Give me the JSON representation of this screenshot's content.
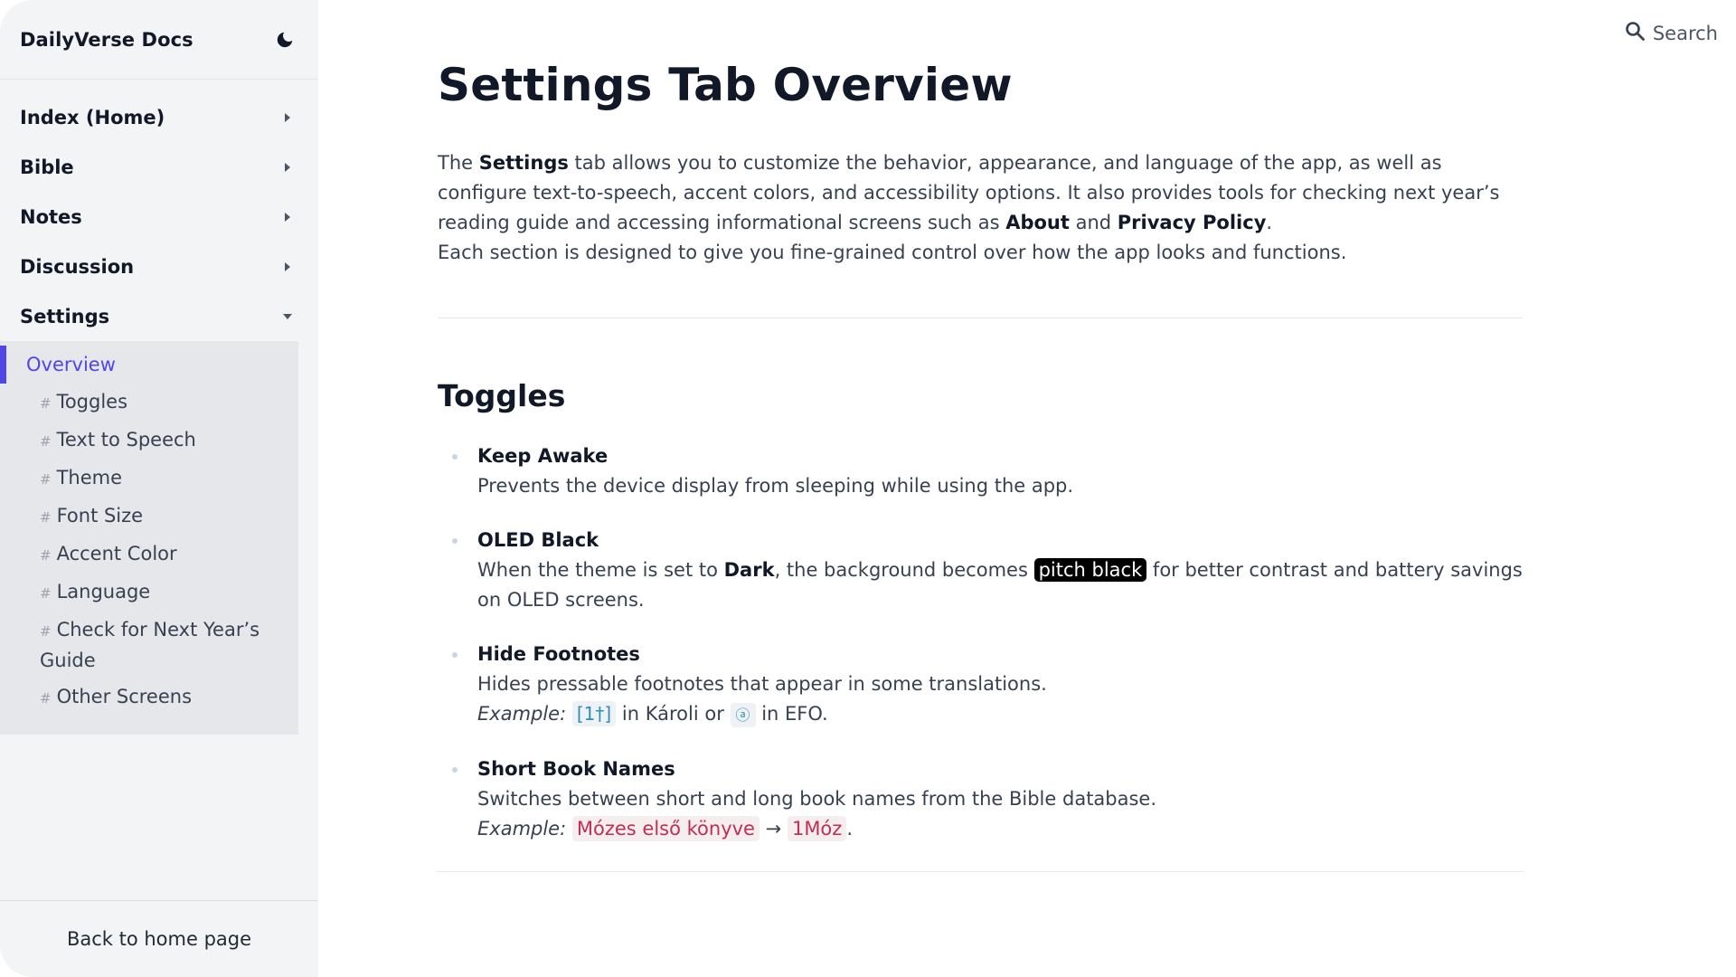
{
  "sidebar": {
    "title": "DailyVerse Docs",
    "theme_toggle_icon": "moon-icon",
    "nav": [
      {
        "label": "Index (Home)",
        "expanded": false
      },
      {
        "label": "Bible",
        "expanded": false
      },
      {
        "label": "Notes",
        "expanded": false
      },
      {
        "label": "Discussion",
        "expanded": false
      },
      {
        "label": "Settings",
        "expanded": true
      }
    ],
    "settings_sub": {
      "active": "Overview",
      "anchor_symbol": "#",
      "anchors": [
        "Toggles",
        "Text to Speech",
        "Theme",
        "Font Size",
        "Accent Color",
        "Language",
        "Check for Next Year’s Guide",
        "Other Screens"
      ]
    },
    "footer_link": "Back to home page",
    "accent_color": "#4f46e5"
  },
  "search": {
    "label": "Search",
    "icon": "search-icon"
  },
  "page": {
    "title": "Settings Tab Overview",
    "intro": {
      "t1": "The ",
      "b1": "Settings",
      "t2": " tab allows you to customize the behavior, appearance, and language of the app, as well as configure text-to-speech, accent colors, and accessibility options. It also provides tools for checking next year’s reading guide and accessing informational screens such as ",
      "b2": "About",
      "t3": " and ",
      "b3": "Privacy Policy",
      "t4": ".",
      "p2": "Each section is designed to give you fine-grained control over how the app looks and functions."
    },
    "toggles": {
      "heading": "Toggles",
      "keep_awake": {
        "title": "Keep Awake",
        "desc": "Prevents the device display from sleeping while using the app."
      },
      "oled_black": {
        "title": "OLED Black",
        "t1": "When the theme is set to ",
        "b1": "Dark",
        "t2": ", the background becomes ",
        "highlight": "pitch black",
        "t3": " for better contrast and battery savings on OLED screens."
      },
      "hide_footnotes": {
        "title": "Hide Footnotes",
        "desc": "Hides pressable footnotes that appear in some translations.",
        "example_label": "Example:",
        "code1": "[1†]",
        "mid": " in Károli or ",
        "code2": "ⓐ",
        "end": " in EFO."
      },
      "short_book_names": {
        "title": "Short Book Names",
        "desc": "Switches between short and long book names from the Bible database.",
        "example_label": "Example:",
        "code1": "Mózes első könyve",
        "arrow": "→",
        "code2": "1Móz",
        "end": "."
      }
    }
  }
}
